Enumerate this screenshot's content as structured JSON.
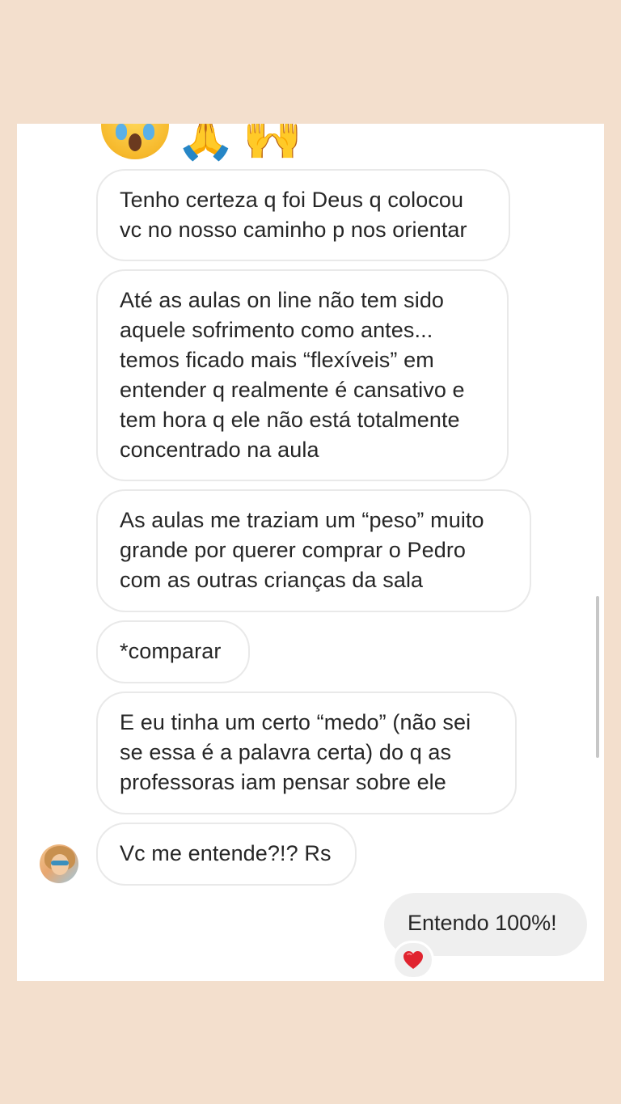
{
  "emojis": [
    "scream-face",
    "folded-hands-blue",
    "raised-hands"
  ],
  "messages": [
    {
      "lines": [
        "Tenho certeza q foi Deus q colocou",
        "vc no nosso caminho p nos orientar"
      ]
    },
    {
      "lines": [
        "Até as aulas on line não tem sido",
        "aquele sofrimento como antes...",
        "temos ficado mais “flexíveis” em",
        "entender q realmente é cansativo e",
        "tem hora q ele não está totalmente",
        "concentrado na aula"
      ]
    },
    {
      "lines": [
        "As aulas me traziam um “peso” muito",
        "grande por querer comprar o Pedro",
        "com as outras crianças da sala"
      ]
    },
    {
      "lines": [
        "*comparar"
      ]
    },
    {
      "lines": [
        "E eu tinha um certo “medo” (não sei",
        "se essa é a palavra certa) do q as",
        "professoras iam pensar sobre ele"
      ]
    },
    {
      "lines": [
        "Vc me entende?!? Rs"
      ]
    }
  ],
  "reply": {
    "text": "Entendo 100%!",
    "reaction": "red-heart"
  },
  "colors": {
    "page_background": "#f3dfcd",
    "incoming_border": "#e9e9e9",
    "outgoing_background": "#efefef",
    "text": "#262626",
    "heart": "#e0242f"
  }
}
